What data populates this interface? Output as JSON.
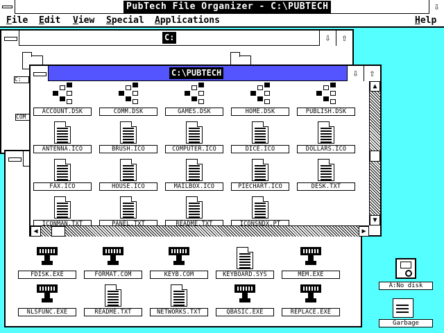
{
  "app": {
    "title": "PubTech File Organizer - C:\\PUBTECH",
    "menus": [
      "File",
      "Edit",
      "View",
      "Special",
      "Applications"
    ],
    "help": "Help"
  },
  "back_window": {
    "title": "C:",
    "partial_labels": [
      "C:",
      "COM"
    ]
  },
  "front_window": {
    "title": "C:\\PUBTECH",
    "items": [
      {
        "label": "ACCOUNT.DSK",
        "icon": "disk-group-icon"
      },
      {
        "label": "COMM.DSK",
        "icon": "disk-group-icon"
      },
      {
        "label": "GAMES.DSK",
        "icon": "disk-group-icon"
      },
      {
        "label": "HOME.DSK",
        "icon": "disk-group-icon"
      },
      {
        "label": "PUBLISH.DSK",
        "icon": "disk-group-icon"
      },
      {
        "label": "ANTENNA.ICO",
        "icon": "document-icon"
      },
      {
        "label": "BRUSH.ICO",
        "icon": "document-icon"
      },
      {
        "label": "COMPUTER.ICO",
        "icon": "document-icon"
      },
      {
        "label": "DICE.ICO",
        "icon": "document-icon"
      },
      {
        "label": "DOLLARS.ICO",
        "icon": "document-icon"
      },
      {
        "label": "FAX.ICO",
        "icon": "document-icon"
      },
      {
        "label": "HOUSE.ICO",
        "icon": "document-icon"
      },
      {
        "label": "MAILBOX.ICO",
        "icon": "document-icon"
      },
      {
        "label": "PIECHART.ICO",
        "icon": "document-icon"
      },
      {
        "label": "DESK.TXT",
        "icon": "document-icon"
      },
      {
        "label": "ICONMAN.TXT",
        "icon": "document-icon"
      },
      {
        "label": "PANEL.TXT",
        "icon": "document-icon"
      },
      {
        "label": "README.TXT",
        "icon": "document-icon"
      },
      {
        "label": "ICONSNDX.PT",
        "icon": "document-icon"
      }
    ]
  },
  "lower_window": {
    "items": [
      {
        "label": "FDISK.EXE",
        "icon": "program-icon"
      },
      {
        "label": "FORMAT.COM",
        "icon": "program-icon"
      },
      {
        "label": "KEYB.COM",
        "icon": "program-icon"
      },
      {
        "label": "KEYBOARD.SYS",
        "icon": "document-icon"
      },
      {
        "label": "MEM.EXE",
        "icon": "program-icon"
      },
      {
        "label": "NLSFUNC.EXE",
        "icon": "program-icon"
      },
      {
        "label": "README.TXT",
        "icon": "document-icon"
      },
      {
        "label": "NETWORKS.TXT",
        "icon": "document-icon"
      },
      {
        "label": "QBASIC.EXE",
        "icon": "program-icon"
      },
      {
        "label": "REPLACE.EXE",
        "icon": "program-icon"
      }
    ]
  },
  "desktop": {
    "drive_label": "A:No disk",
    "trash_label": "Garbage"
  }
}
